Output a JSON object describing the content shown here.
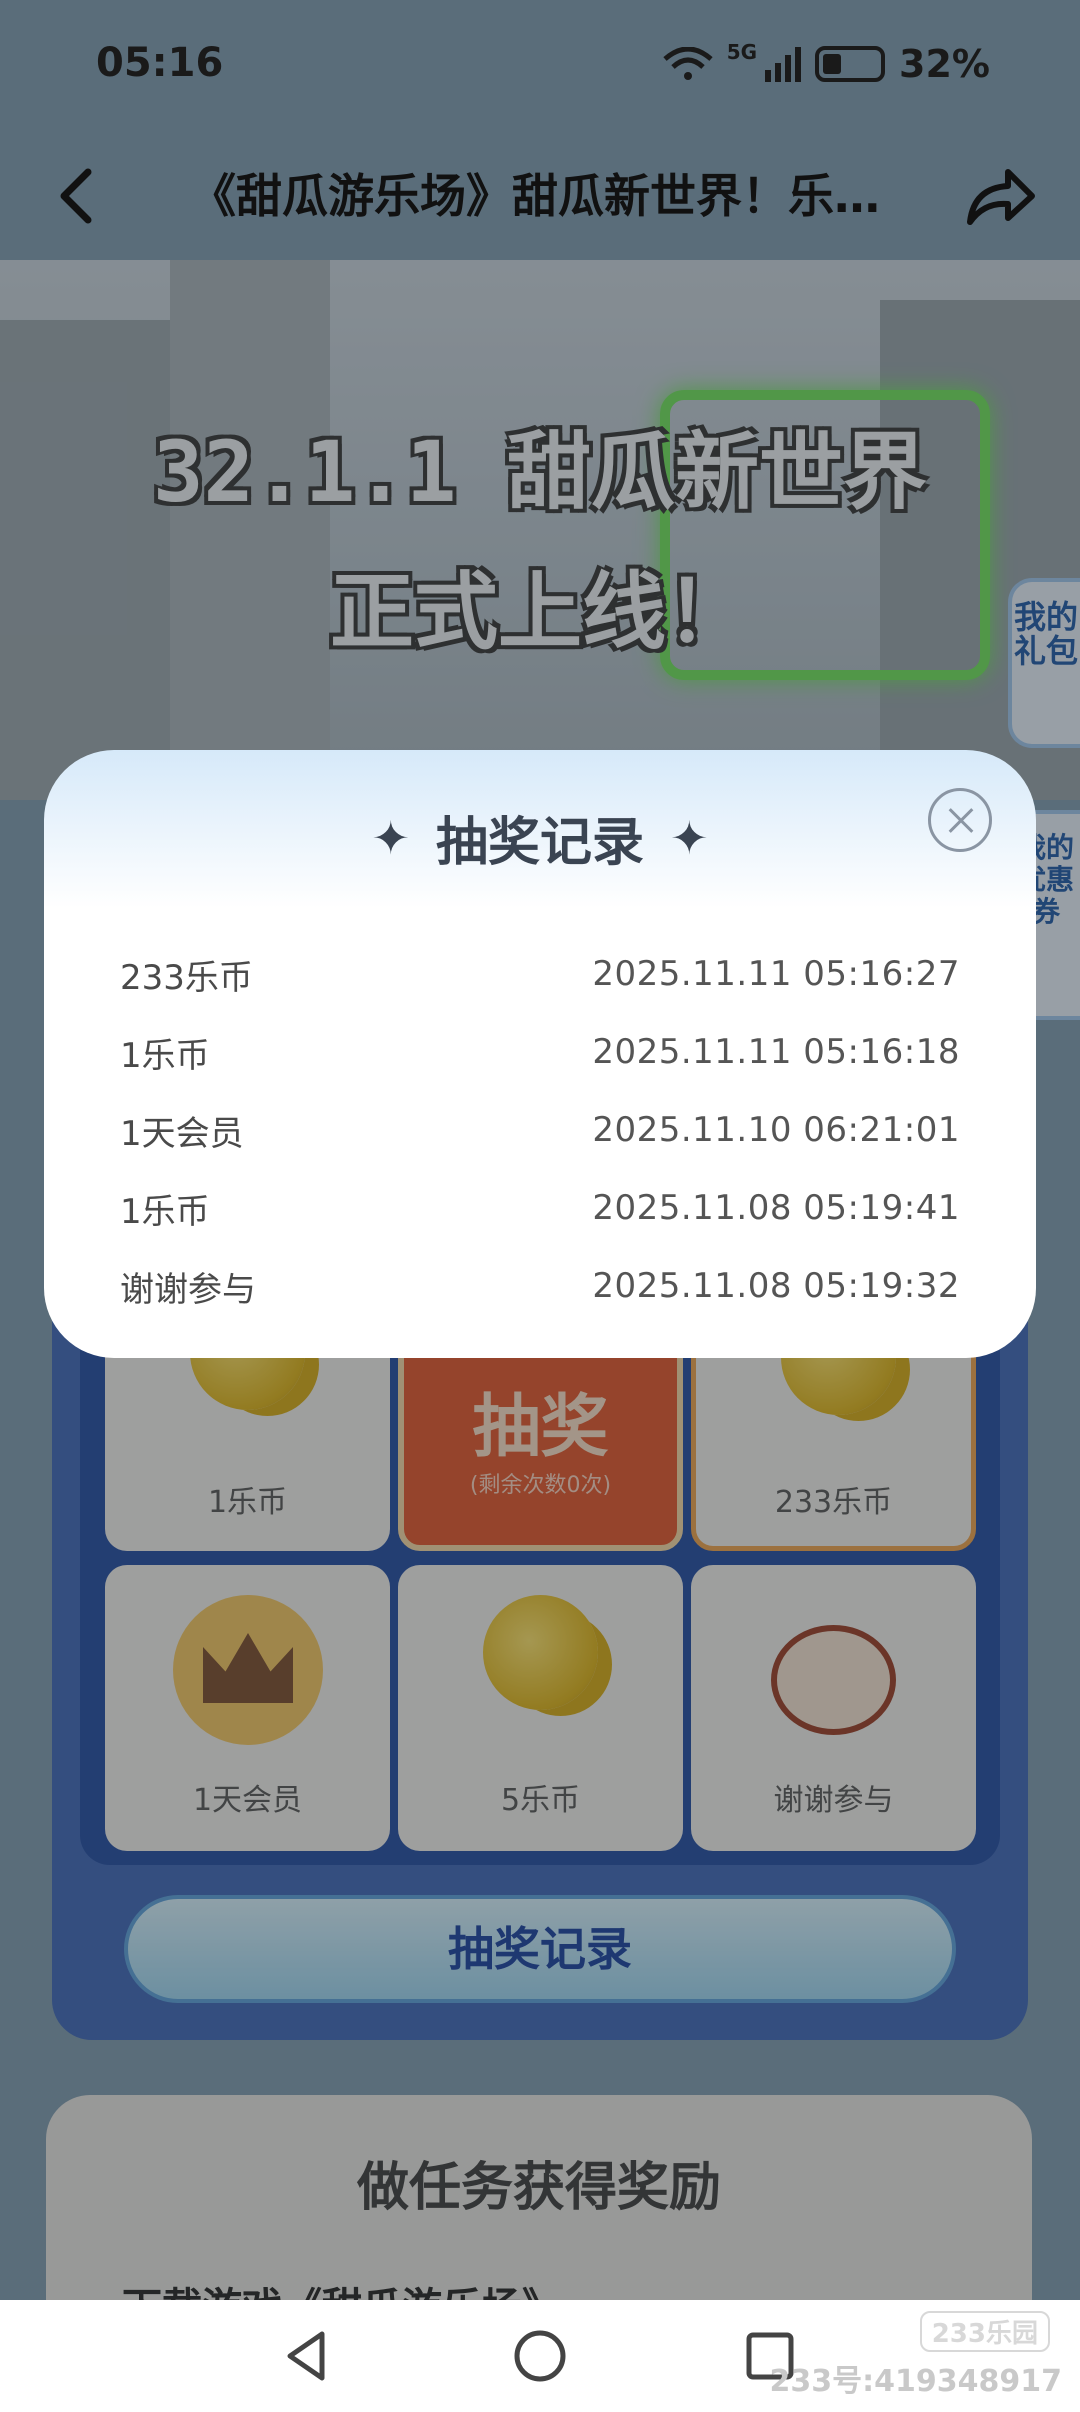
{
  "status_bar": {
    "time": "05:16",
    "network": "5G",
    "battery": "32%"
  },
  "header": {
    "title": "《甜瓜游乐场》甜瓜新世界！乐…",
    "back_icon": "chevron-left-icon",
    "share_icon": "share-arrow-icon"
  },
  "banner": {
    "line1": "32.1.1 甜瓜新世界",
    "line2": "正式上线！"
  },
  "side_tabs": {
    "gift": "我的礼包",
    "coupon": "我的优惠券"
  },
  "dialog": {
    "title": "抽奖记录",
    "records": [
      {
        "prize": "233乐币",
        "time": "2025.11.11 05:16:27"
      },
      {
        "prize": "1乐币",
        "time": "2025.11.11 05:16:18"
      },
      {
        "prize": "1天会员",
        "time": "2025.11.10 06:21:01"
      },
      {
        "prize": "1乐币",
        "time": "2025.11.08 05:19:41"
      },
      {
        "prize": "谢谢参与",
        "time": "2025.11.08 05:19:32"
      }
    ]
  },
  "lottery": {
    "cells": [
      {
        "label": "1乐币",
        "icon": "coin-icon"
      },
      {
        "label": "233乐币",
        "icon": "coin-icon"
      },
      {
        "label": "1天会员",
        "icon": "crown-icon"
      },
      {
        "label": "5乐币",
        "icon": "coin-icon"
      },
      {
        "label": "谢谢参与",
        "icon": "mascot-icon"
      }
    ],
    "draw": {
      "label": "抽奖",
      "remaining": "(剩余次数0次)"
    },
    "record_button": "抽奖记录"
  },
  "tasks": {
    "title": "做任务获得奖励",
    "first_item": "下载游戏《甜瓜游乐场》"
  },
  "watermark": {
    "logo": "233乐园",
    "id": "233号:419348917"
  }
}
